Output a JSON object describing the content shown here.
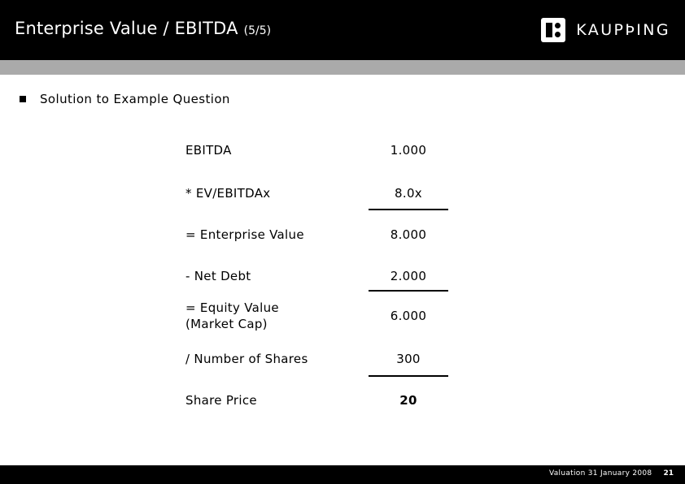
{
  "slide": {
    "title": "Enterprise Value / EBITDA",
    "title_sub": "(5/5)",
    "brand": {
      "name": "KAUPÞING",
      "logo_icon": "kaupthing-square-mark"
    },
    "colors": {
      "header_bg": "#000000",
      "separator": "#aaaaaa",
      "body_bg": "#ffffff",
      "text": "#000000",
      "header_text": "#ffffff"
    }
  },
  "body": {
    "bullet": {
      "marker_icon": "square-bullet",
      "text": "Solution to Example Question"
    }
  },
  "calc_table": {
    "rows": [
      {
        "label": "EBITDA",
        "value": "1.000",
        "bold": false,
        "rule_after": false
      },
      {
        "label": "* EV/EBITDAx",
        "value": "8.0x",
        "bold": false,
        "rule_after": true
      },
      {
        "label": "= Enterprise Value",
        "value": "8.000",
        "bold": false,
        "rule_after": false
      },
      {
        "label": "- Net Debt",
        "value": "2.000",
        "bold": false,
        "rule_after": true
      },
      {
        "label": "= Equity Value\n(Market Cap)",
        "value": "6.000",
        "bold": false,
        "rule_after": false
      },
      {
        "label": "/ Number of Shares",
        "value": "300",
        "bold": false,
        "rule_after": true
      },
      {
        "label": "Share Price",
        "value": "20",
        "bold": true,
        "rule_after": false
      }
    ]
  },
  "footer": {
    "note": "Valuation 31 January 2008",
    "page": "21"
  }
}
